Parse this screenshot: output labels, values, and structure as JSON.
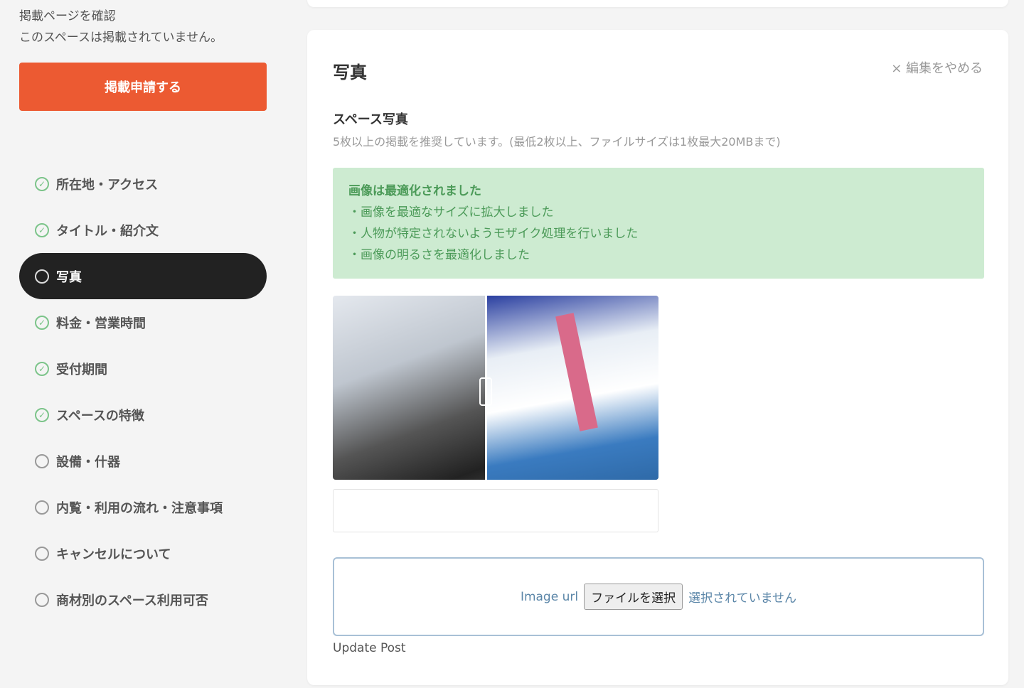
{
  "sidebar": {
    "check_page": "掲載ページを確認",
    "status": "このスペースは掲載されていません。",
    "apply_button": "掲載申請する",
    "items": [
      {
        "label": "所在地・アクセス",
        "done": true
      },
      {
        "label": "タイトル・紹介文",
        "done": true
      },
      {
        "label": "写真",
        "done": false,
        "active": true
      },
      {
        "label": "料金・営業時間",
        "done": true
      },
      {
        "label": "受付期間",
        "done": true
      },
      {
        "label": "スペースの特徴",
        "done": true
      },
      {
        "label": "設備・什器",
        "done": false
      },
      {
        "label": "内覧・利用の流れ・注意事項",
        "done": false
      },
      {
        "label": "キャンセルについて",
        "done": false
      },
      {
        "label": "商材別のスペース利用可否",
        "done": false
      }
    ]
  },
  "main": {
    "title": "写真",
    "cancel_edit": "× 編集をやめる",
    "section_title": "スペース写真",
    "section_desc": "5枚以上の掲載を推奨しています。(最低2枚以上、ファイルサイズは1枚最大20MBまで)",
    "alert": {
      "title": "画像は最適化されました",
      "lines": [
        "・画像を最適なサイズに拡大しました",
        "・人物が特定されないようモザイク処理を行いました",
        "・画像の明るさを最適化しました"
      ]
    },
    "upload": {
      "label": "Image url",
      "button": "ファイルを選択",
      "status": "選択されていません"
    },
    "update_post": "Update Post"
  },
  "colors": {
    "accent": "#ec5a32",
    "success_bg": "#cdebd1",
    "success_text": "#4b9a58",
    "active_nav": "#222222"
  }
}
